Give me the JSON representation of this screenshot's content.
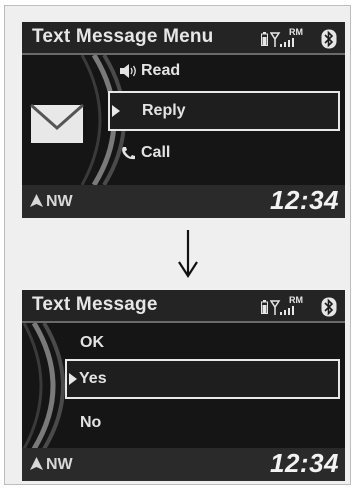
{
  "colors": {
    "screen_bg": "#1b1b1b",
    "text": "#e6e6e6",
    "selection_border": "#e8e8e8",
    "bottombar_bg": "#2a2a2a"
  },
  "icons": {
    "status": [
      "battery-icon",
      "signal-icon",
      "bluetooth-icon"
    ],
    "menu": [
      "speaker-icon",
      "reply-pointer-icon",
      "phone-icon"
    ],
    "left": "envelope-icon",
    "transition": "down-arrow-icon",
    "compass": "nav-arrow-icon"
  },
  "screen1": {
    "title": "Text Message Menu",
    "status": {
      "roam": "RM"
    },
    "menu": [
      {
        "label": "Read",
        "icon": "speaker-icon",
        "selected": false
      },
      {
        "label": "Reply",
        "icon": "pointer-icon",
        "selected": true
      },
      {
        "label": "Call",
        "icon": "phone-icon",
        "selected": false
      }
    ],
    "footer": {
      "heading": "NW",
      "time": "12:34"
    }
  },
  "screen2": {
    "title": "Text Message",
    "status": {
      "roam": "RM"
    },
    "menu": [
      {
        "label": "OK",
        "selected": false
      },
      {
        "label": "Yes",
        "selected": true
      },
      {
        "label": "No",
        "selected": false
      }
    ],
    "footer": {
      "heading": "NW",
      "time": "12:34"
    }
  }
}
